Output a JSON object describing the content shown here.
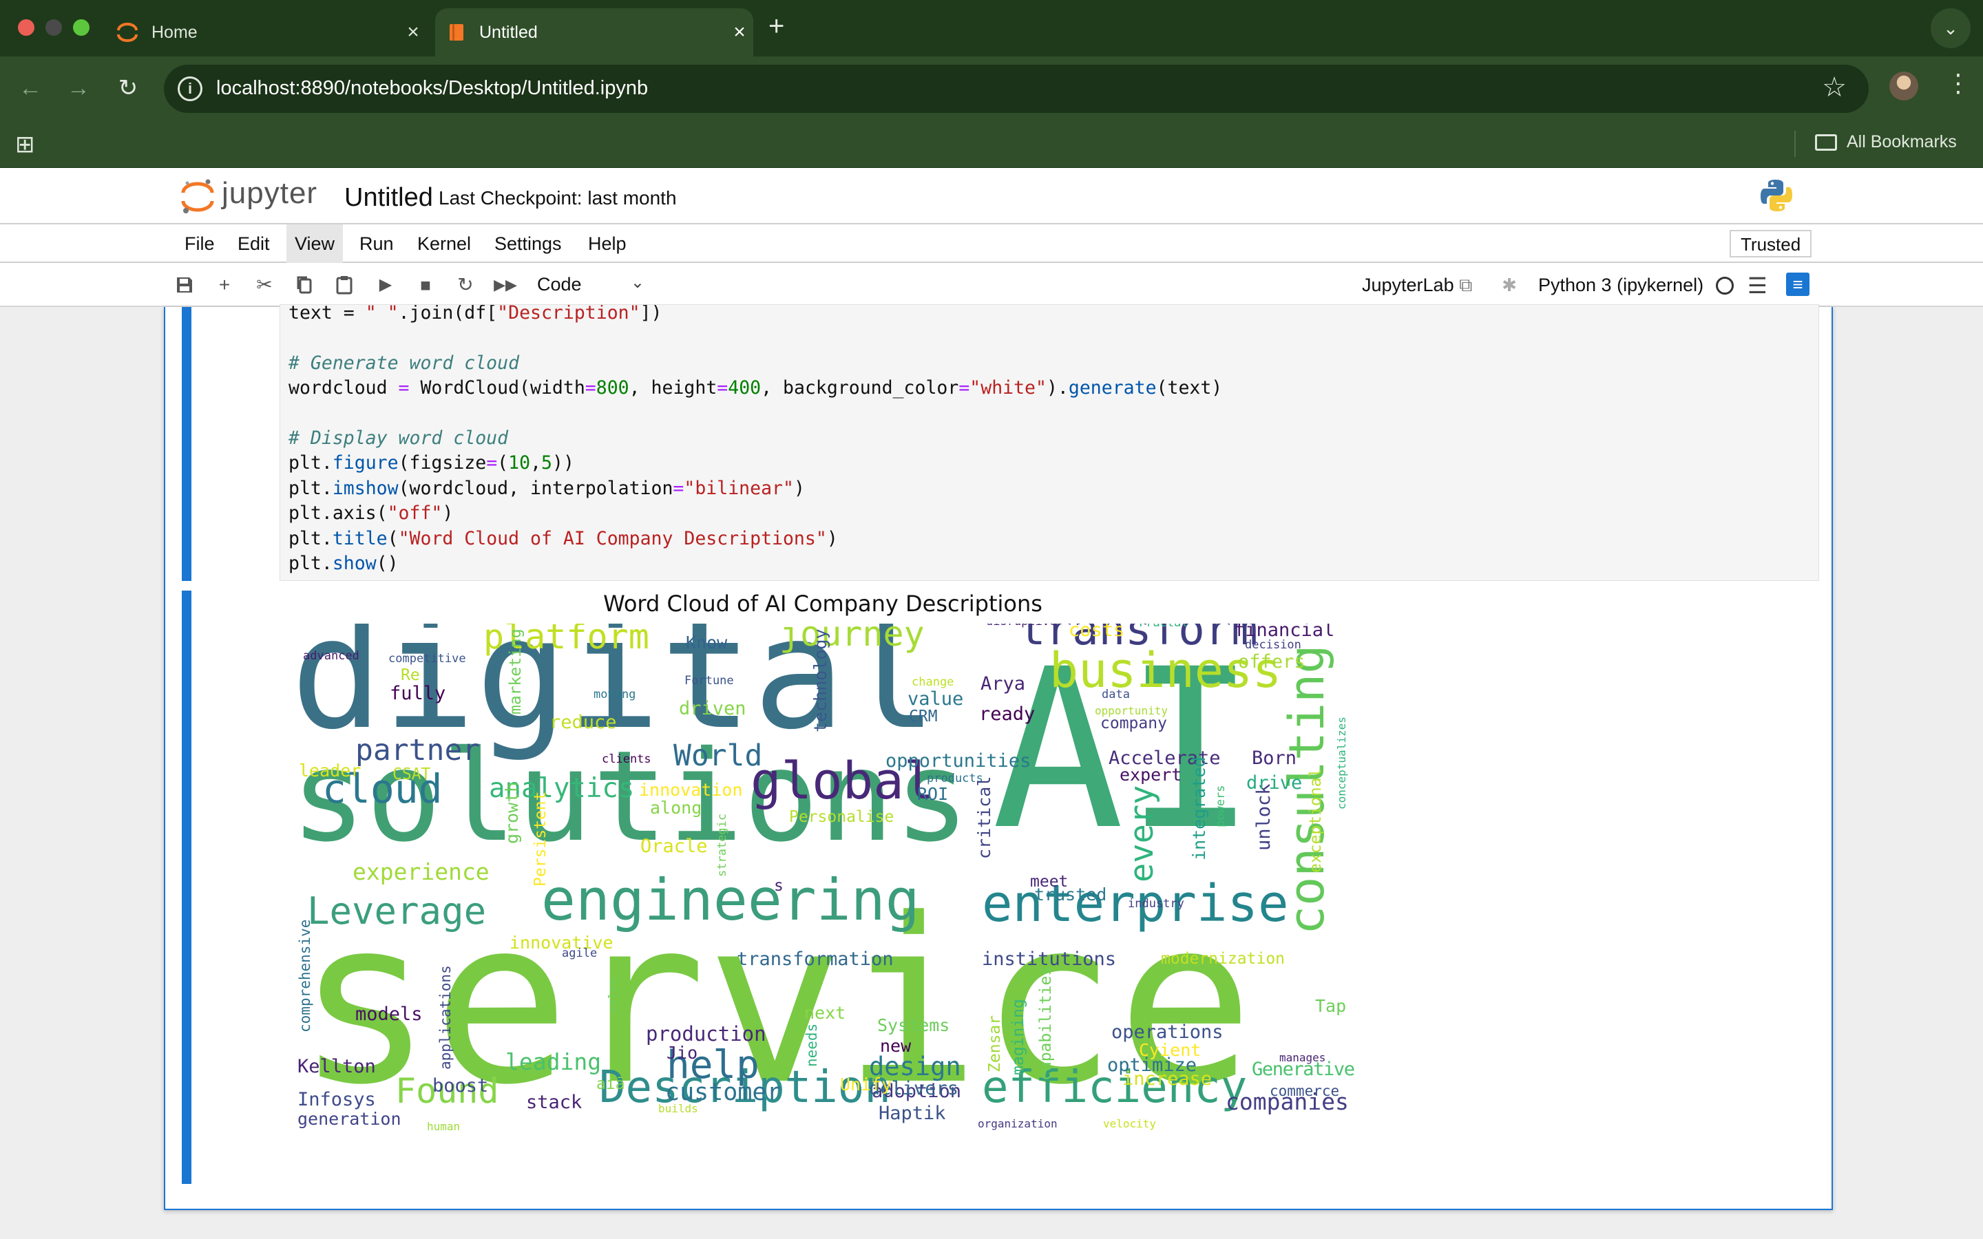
{
  "browser": {
    "tabs": [
      {
        "title": "Home",
        "active": false
      },
      {
        "title": "Untitled",
        "active": true
      }
    ],
    "new_tab": "+",
    "url": "localhost:8890/notebooks/Desktop/Untitled.ipynb",
    "bookmarks_label": "All Bookmarks"
  },
  "jupyter": {
    "logo_text": "jupyter",
    "notebook_title": "Untitled",
    "checkpoint": "Last Checkpoint: last month",
    "menu": [
      "File",
      "Edit",
      "View",
      "Run",
      "Kernel",
      "Settings",
      "Help"
    ],
    "active_menu": "View",
    "trusted": "Trusted",
    "cell_type": "Code",
    "jupyterlab_link": "JupyterLab",
    "kernel": "Python 3 (ipykernel)"
  },
  "code_cell": {
    "lines": [
      "text = \" \".join(df[\"Description\"])",
      "",
      "# Generate word cloud",
      "wordcloud = WordCloud(width=800, height=400, background_color=\"white\").generate(text)",
      "",
      "# Display word cloud",
      "plt.figure(figsize=(10,5))",
      "plt.imshow(wordcloud, interpolation=\"bilinear\")",
      "plt.axis(\"off\")",
      "plt.title(\"Word Cloud of AI Company Descriptions\")",
      "plt.show()"
    ]
  },
  "output": {
    "title": "Word Cloud of AI Company Descriptions",
    "words": [
      {
        "text": "service",
        "size": 340,
        "color": "#7ac943"
      },
      {
        "text": "digital",
        "size": 230,
        "color": "#3b7187"
      },
      {
        "text": "solutions",
        "size": 188,
        "color": "#41a073"
      },
      {
        "text": "AI",
        "size": 330,
        "color": "#3fa977"
      },
      {
        "text": "engineering",
        "size": 86,
        "color": "#3b9d7c"
      },
      {
        "text": "enterprise",
        "size": 76,
        "color": "#24858d"
      },
      {
        "text": "consulting",
        "size": 72,
        "color": "#63c85a"
      },
      {
        "text": "business",
        "size": 72,
        "color": "#b7de2a"
      },
      {
        "text": "transform",
        "size": 66,
        "color": "#3e3c80"
      },
      {
        "text": "global",
        "size": 76,
        "color": "#482878"
      },
      {
        "text": "Description",
        "size": 66,
        "color": "#2f8e8c"
      },
      {
        "text": "efficiency",
        "size": 66,
        "color": "#34a07a"
      },
      {
        "text": "cloud",
        "size": 60,
        "color": "#2a788e"
      },
      {
        "text": "Leverage",
        "size": 56,
        "color": "#3b9e7e"
      },
      {
        "text": "journey",
        "size": 52,
        "color": "#a6db35"
      },
      {
        "text": "platform",
        "size": 52,
        "color": "#c2df23"
      },
      {
        "text": "Found",
        "size": 52,
        "color": "#86d549"
      },
      {
        "text": "help",
        "size": 58,
        "color": "#2d6f8e"
      },
      {
        "text": "partner",
        "size": 44,
        "color": "#3b528b"
      },
      {
        "text": "World",
        "size": 44,
        "color": "#2f6c8e"
      },
      {
        "text": "analytics",
        "size": 40,
        "color": "#35b779"
      },
      {
        "text": "every",
        "size": 48,
        "color": "#2fb47c"
      },
      {
        "text": "customer",
        "size": 36,
        "color": "#2c728e"
      },
      {
        "text": "experience",
        "size": 34,
        "color": "#a0da39"
      },
      {
        "text": "design",
        "size": 38,
        "color": "#2a788e"
      },
      {
        "text": "leading",
        "size": 34,
        "color": "#4ac16d"
      },
      {
        "text": "companies",
        "size": 34,
        "color": "#433e85"
      },
      {
        "text": "transformation",
        "size": 28,
        "color": "#31688e"
      },
      {
        "text": "institutions",
        "size": 28,
        "color": "#3e4989"
      },
      {
        "text": "Generative",
        "size": 28,
        "color": "#4ac16d"
      },
      {
        "text": "production",
        "size": 30,
        "color": "#482878"
      },
      {
        "text": "operations",
        "size": 28,
        "color": "#3b528b"
      },
      {
        "text": "Accelerate",
        "size": 28,
        "color": "#472c7a"
      },
      {
        "text": "opportunities",
        "size": 28,
        "color": "#2a788e"
      },
      {
        "text": "models",
        "size": 28,
        "color": "#471164"
      },
      {
        "text": "Kellton",
        "size": 28,
        "color": "#482475"
      },
      {
        "text": "Infosys",
        "size": 28,
        "color": "#3e4c8a"
      },
      {
        "text": "generation",
        "size": 26,
        "color": "#414487"
      },
      {
        "text": "stack",
        "size": 28,
        "color": "#482475"
      },
      {
        "text": "boost",
        "size": 28,
        "color": "#3e4989"
      },
      {
        "text": "Haptik",
        "size": 28,
        "color": "#3b528b"
      },
      {
        "text": "adoption",
        "size": 28,
        "color": "#453781"
      },
      {
        "text": "delivers",
        "size": 28,
        "color": "#33638d"
      },
      {
        "text": "optimize",
        "size": 28,
        "color": "#2c728e"
      },
      {
        "text": "increase",
        "size": 28,
        "color": "#d8e219"
      },
      {
        "text": "Cyient",
        "size": 26,
        "color": "#fde725"
      },
      {
        "text": "Systems",
        "size": 26,
        "color": "#6ccd5a"
      },
      {
        "text": "Tap",
        "size": 26,
        "color": "#6ece58"
      },
      {
        "text": "next",
        "size": 26,
        "color": "#86d549"
      },
      {
        "text": "new",
        "size": 26,
        "color": "#440154"
      },
      {
        "text": "Jio",
        "size": 26,
        "color": "#482475"
      },
      {
        "text": "Unify",
        "size": 26,
        "color": "#fde725"
      },
      {
        "text": "innovative",
        "size": 26,
        "color": "#d2e21b"
      },
      {
        "text": "agile",
        "size": 18,
        "color": "#3e4989"
      },
      {
        "text": "sales",
        "size": 18,
        "color": "#6ece58"
      },
      {
        "text": "aiā",
        "size": 24,
        "color": "#84d44b"
      },
      {
        "text": "builds",
        "size": 16,
        "color": "#b5de2b"
      },
      {
        "text": "human",
        "size": 16,
        "color": "#a0da39"
      },
      {
        "text": "organization",
        "size": 16,
        "color": "#453781"
      },
      {
        "text": "velocity",
        "size": 16,
        "color": "#c8e020"
      },
      {
        "text": "commerce",
        "size": 22,
        "color": "#3b528b"
      },
      {
        "text": "manages",
        "size": 16,
        "color": "#482475"
      },
      {
        "text": "modernization",
        "size": 24,
        "color": "#c2df23"
      },
      {
        "text": "industry",
        "size": 18,
        "color": "#433e85"
      },
      {
        "text": "trusted",
        "size": 26,
        "color": "#2a788e"
      },
      {
        "text": "meet",
        "size": 24,
        "color": "#482878"
      },
      {
        "text": "unlock",
        "size": 28,
        "color": "#424086"
      },
      {
        "text": "exceptional",
        "size": 24,
        "color": "#b5de2b"
      },
      {
        "text": "integrated",
        "size": 26,
        "color": "#1f9e89"
      },
      {
        "text": "powers",
        "size": 18,
        "color": "#3fbc73"
      },
      {
        "text": "drive",
        "size": 28,
        "color": "#25ab82"
      },
      {
        "text": "conceptualizes",
        "size": 16,
        "color": "#2fb47c"
      },
      {
        "text": "expert",
        "size": 26,
        "color": "#471164"
      },
      {
        "text": "Born",
        "size": 28,
        "color": "#472a7a"
      },
      {
        "text": "company",
        "size": 24,
        "color": "#433e85"
      },
      {
        "text": "opportunity",
        "size": 16,
        "color": "#a8db34"
      },
      {
        "text": "ready",
        "size": 28,
        "color": "#440154"
      },
      {
        "text": "Arya",
        "size": 28,
        "color": "#482576"
      },
      {
        "text": "data",
        "size": 18,
        "color": "#3b528b"
      },
      {
        "text": "offers",
        "size": 28,
        "color": "#a8db34"
      },
      {
        "text": "decision",
        "size": 18,
        "color": "#433e85"
      },
      {
        "text": "financial",
        "size": 28,
        "color": "#481a6c"
      },
      {
        "text": "Fractal",
        "size": 18,
        "color": "#2fb47c"
      },
      {
        "text": "costs",
        "size": 28,
        "color": "#fde725"
      },
      {
        "text": "disruptive",
        "size": 18,
        "color": "#482475"
      },
      {
        "text": "change",
        "size": 18,
        "color": "#bddf26"
      },
      {
        "text": "value",
        "size": 28,
        "color": "#2a788e"
      },
      {
        "text": "CRM",
        "size": 24,
        "color": "#31688e"
      },
      {
        "text": "technology",
        "size": 26,
        "color": "#38588c"
      },
      {
        "text": "Know",
        "size": 26,
        "color": "#33638d"
      },
      {
        "text": "Fortune",
        "size": 18,
        "color": "#3b528b"
      },
      {
        "text": "driven",
        "size": 28,
        "color": "#86d549"
      },
      {
        "text": "moving",
        "size": 18,
        "color": "#2a788e"
      },
      {
        "text": "reduce",
        "size": 28,
        "color": "#c2df23"
      },
      {
        "text": "clients",
        "size": 18,
        "color": "#440154"
      },
      {
        "text": "products",
        "size": 18,
        "color": "#2c728e"
      },
      {
        "text": "ROI",
        "size": 26,
        "color": "#2d6f8e"
      },
      {
        "text": "innovation",
        "size": 26,
        "color": "#fde725"
      },
      {
        "text": "along",
        "size": 26,
        "color": "#86d549"
      },
      {
        "text": "Personalise",
        "size": 24,
        "color": "#b5de2b"
      },
      {
        "text": "critical",
        "size": 26,
        "color": "#414487"
      },
      {
        "text": "strategic",
        "size": 18,
        "color": "#6ece58"
      },
      {
        "text": "Oracle",
        "size": 28,
        "color": "#d8e219"
      },
      {
        "text": "s",
        "size": 24,
        "color": "#482475"
      },
      {
        "text": "Persistent",
        "size": 24,
        "color": "#fde725"
      },
      {
        "text": "growth",
        "size": 26,
        "color": "#6ece58"
      },
      {
        "text": "marketing",
        "size": 24,
        "color": "#6ece58"
      },
      {
        "text": "CSAT",
        "size": 24,
        "color": "#c2df23"
      },
      {
        "text": "leader",
        "size": 26,
        "color": "#d8e219"
      },
      {
        "text": "fully",
        "size": 28,
        "color": "#440154"
      },
      {
        "text": "Re",
        "size": 24,
        "color": "#b5de2b"
      },
      {
        "text": "competitive",
        "size": 18,
        "color": "#3b528b"
      },
      {
        "text": "advanced",
        "size": 18,
        "color": "#481a6c"
      },
      {
        "text": "comprehensive",
        "size": 22,
        "color": "#2c728e"
      },
      {
        "text": "applications",
        "size": 22,
        "color": "#3e4989"
      },
      {
        "text": "needs",
        "size": 22,
        "color": "#2fb47c"
      },
      {
        "text": "Zensar",
        "size": 24,
        "color": "#a0da39"
      },
      {
        "text": "magining",
        "size": 24,
        "color": "#35b779"
      },
      {
        "text": "capabilities",
        "size": 24,
        "color": "#6ece58"
      }
    ]
  }
}
